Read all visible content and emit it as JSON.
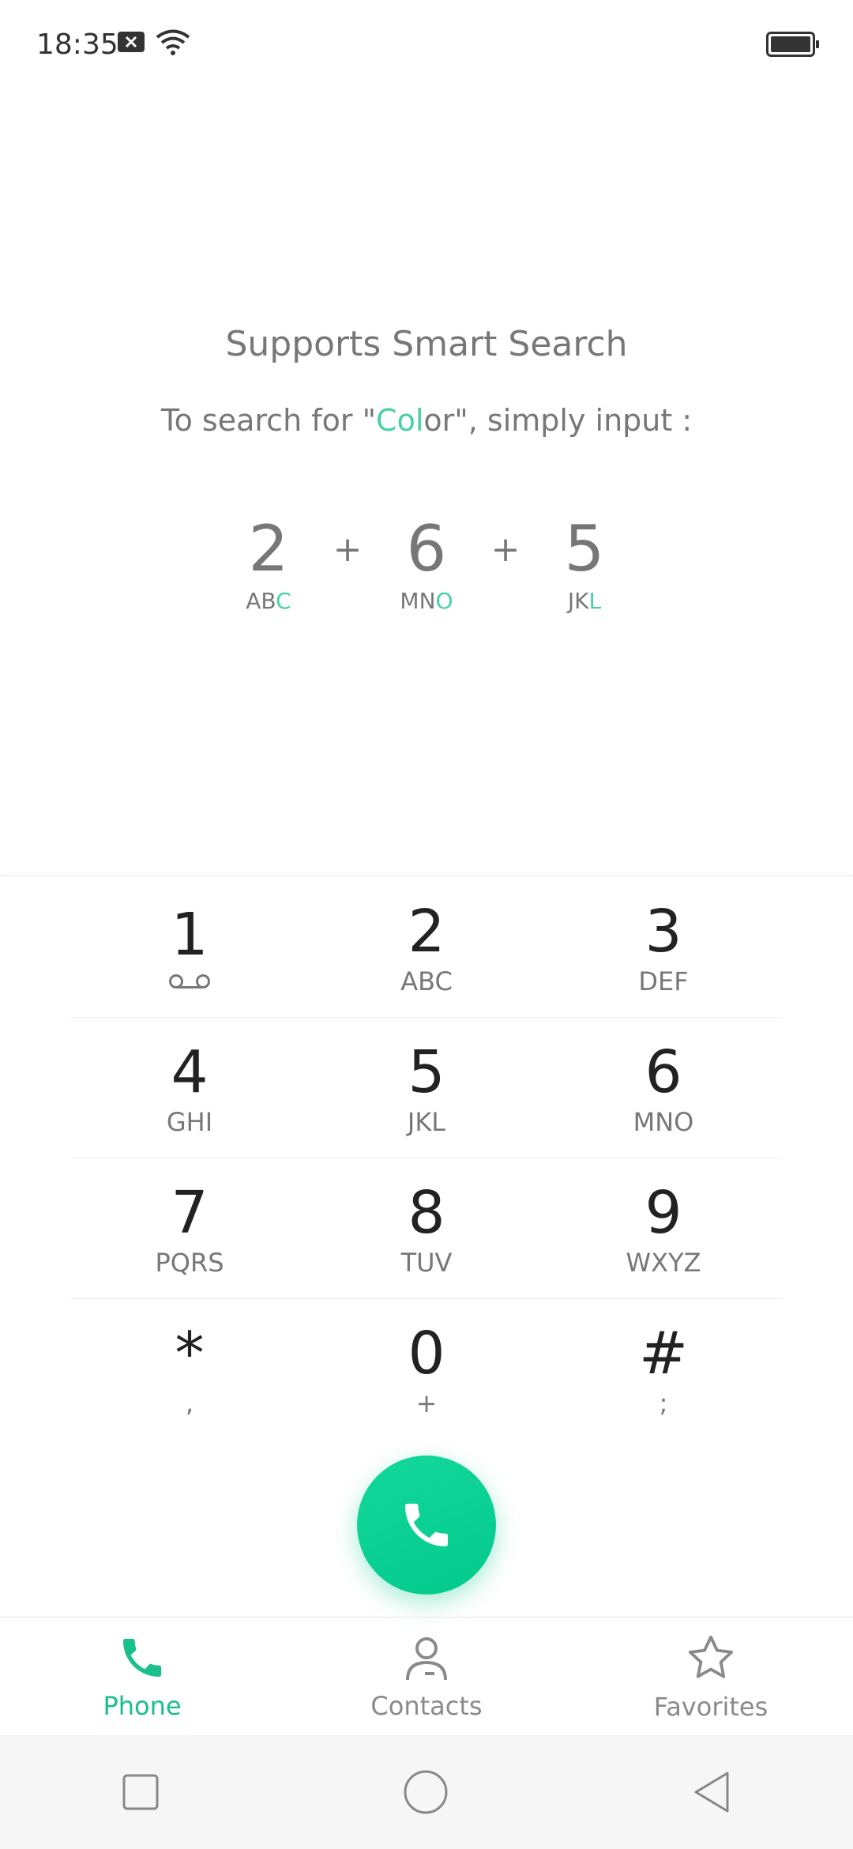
{
  "status": {
    "time": "18:35"
  },
  "hint": {
    "title": "Supports Smart Search",
    "sub_prefix": "To search for \"",
    "sub_accent": "Col",
    "sub_suffix": "or\", simply input :"
  },
  "example": {
    "plus": "+",
    "keys": [
      {
        "digit": "2",
        "letters_plain": "AB",
        "letters_accent": "C"
      },
      {
        "digit": "6",
        "letters_plain": "MN",
        "letters_accent": "O"
      },
      {
        "digit": "5",
        "letters_plain": "JK",
        "letters_accent": "L"
      }
    ]
  },
  "dialpad": {
    "keys": [
      {
        "digit": "1",
        "letters": ""
      },
      {
        "digit": "2",
        "letters": "ABC"
      },
      {
        "digit": "3",
        "letters": "DEF"
      },
      {
        "digit": "4",
        "letters": "GHI"
      },
      {
        "digit": "5",
        "letters": "JKL"
      },
      {
        "digit": "6",
        "letters": "MNO"
      },
      {
        "digit": "7",
        "letters": "PQRS"
      },
      {
        "digit": "8",
        "letters": "TUV"
      },
      {
        "digit": "9",
        "letters": "WXYZ"
      },
      {
        "digit": "*",
        "letters": ","
      },
      {
        "digit": "0",
        "letters": "+"
      },
      {
        "digit": "#",
        "letters": ";"
      }
    ]
  },
  "tabs": [
    {
      "label": "Phone",
      "active": true
    },
    {
      "label": "Contacts",
      "active": false
    },
    {
      "label": "Favorites",
      "active": false
    }
  ],
  "colors": {
    "accent": "#19c08b",
    "hint_accent": "#46d1a5",
    "call_button": "#0ad294"
  }
}
